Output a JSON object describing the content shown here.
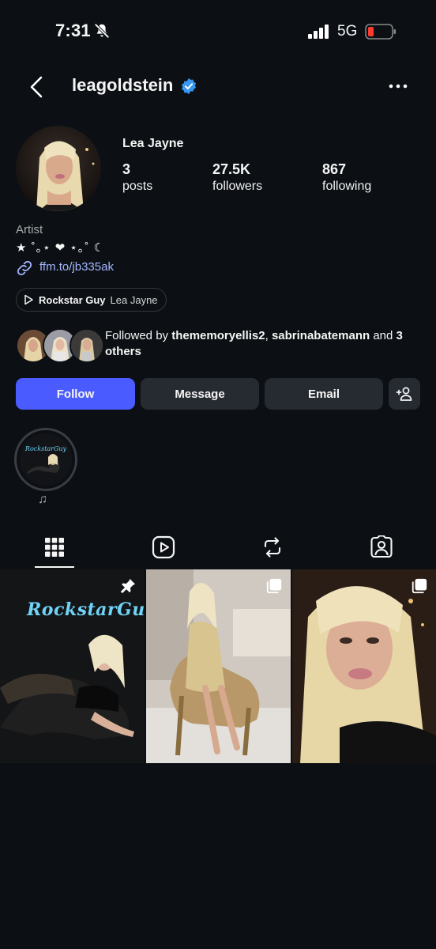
{
  "status_bar": {
    "time": "7:31",
    "network": "5G"
  },
  "header": {
    "username": "leagoldstein"
  },
  "profile": {
    "full_name": "Lea Jayne",
    "stats": [
      {
        "value": "3",
        "label": "posts"
      },
      {
        "value": "27.5K",
        "label": "followers"
      },
      {
        "value": "867",
        "label": "following"
      }
    ],
    "category": "Artist",
    "bio": "★ ˚｡⋆ ❤ ⋆｡˚ ☾",
    "link": "ffm.to/jb335ak",
    "music": {
      "song": "Rockstar Guy",
      "artist": "Lea Jayne"
    }
  },
  "followed_by": {
    "prefix": "Followed by ",
    "user1": "thememoryellis2",
    "sep": ", ",
    "user2": "sabrinabatemann",
    "and": " and ",
    "others": "3 others"
  },
  "buttons": {
    "follow": "Follow",
    "message": "Message",
    "email": "Email"
  },
  "highlight": {
    "note": "♫"
  },
  "grid": {
    "post1_overlay": "RockstarGuy"
  },
  "colors": {
    "accent": "#4a5cff",
    "link": "#a3b6ff",
    "verified": "#3897f0",
    "background": "#0c1014"
  }
}
